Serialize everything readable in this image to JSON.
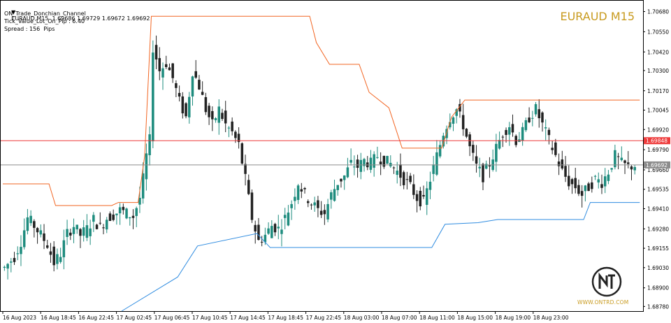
{
  "header": {
    "symbol_line": "EURAUD,M15  1.69686 1.69729 1.69672 1.69692",
    "indicator_name": "ON_Trade_Donchian_Channel",
    "tick_value": "Tick_Value_Lot_On_Pip : 6.40",
    "spread": "Spread : 156  Pips"
  },
  "chart_title": "EURAUD M15",
  "logo": {
    "text": "WWW.ONTRD.COM",
    "icon": "ontrd-logo-icon"
  },
  "colors": {
    "upper_band": "#f26522",
    "lower_band": "#2f8ce0",
    "hline_red": "#ee3b3b",
    "hline_gray": "#8c8c8c",
    "candle": "#1e8c7e",
    "candle_dark": "#222222",
    "title": "#c89a1e"
  },
  "price_axis": {
    "ticks": [
      "1.70680",
      "1.70550",
      "1.70420",
      "1.70300",
      "1.70170",
      "1.70045",
      "1.69920",
      "1.69790",
      "1.69660",
      "1.69535",
      "1.69410",
      "1.69280",
      "1.69155",
      "1.69030",
      "1.68900",
      "1.68780"
    ],
    "labels": [
      {
        "value": "1.69848",
        "color": "#ee3b3b"
      },
      {
        "value": "1.69692",
        "color": "#8c8c8c"
      }
    ]
  },
  "time_axis": [
    "16 Aug 2023",
    "16 Aug 18:45",
    "16 Aug 22:45",
    "17 Aug 02:45",
    "17 Aug 06:45",
    "17 Aug 10:45",
    "17 Aug 14:45",
    "17 Aug 18:45",
    "17 Aug 22:45",
    "18 Aug 03:00",
    "18 Aug 07:00",
    "18 Aug 11:00",
    "18 Aug 15:00",
    "18 Aug 19:00",
    "18 Aug 23:00"
  ],
  "chart_data": {
    "type": "line",
    "title": "EURAUD M15",
    "ylim": [
      1.6875,
      1.7075
    ],
    "hlines": [
      1.69848,
      1.69692
    ],
    "series": [
      {
        "name": "",
        "values": []
      }
    ],
    "close_path": [
      [
        0,
        1.6903
      ],
      [
        3,
        1.691
      ],
      [
        5,
        1.692
      ],
      [
        7,
        1.6935
      ],
      [
        9,
        1.693
      ],
      [
        11,
        1.6924
      ],
      [
        13,
        1.6918
      ],
      [
        15,
        1.6906
      ],
      [
        17,
        1.6912
      ],
      [
        19,
        1.6925
      ],
      [
        21,
        1.693
      ],
      [
        23,
        1.6924
      ],
      [
        25,
        1.6928
      ],
      [
        27,
        1.6934
      ],
      [
        29,
        1.6929
      ],
      [
        31,
        1.6935
      ],
      [
        33,
        1.6937
      ],
      [
        35,
        1.694
      ],
      [
        37,
        1.6938
      ],
      [
        39,
        1.6936
      ],
      [
        41,
        1.6948
      ],
      [
        42,
        1.696
      ],
      [
        43,
        1.6975
      ],
      [
        44,
        1.6985
      ],
      [
        45,
        1.7045
      ],
      [
        46,
        1.7038
      ],
      [
        47,
        1.703
      ],
      [
        49,
        1.7035
      ],
      [
        51,
        1.7025
      ],
      [
        53,
        1.701
      ],
      [
        55,
        1.7
      ],
      [
        57,
        1.703
      ],
      [
        59,
        1.702
      ],
      [
        61,
        1.7005
      ],
      [
        63,
        1.6995
      ],
      [
        65,
        1.7005
      ],
      [
        67,
        1.6995
      ],
      [
        69,
        1.699
      ],
      [
        71,
        1.6982
      ],
      [
        73,
        1.696
      ],
      [
        75,
        1.6935
      ],
      [
        77,
        1.692
      ],
      [
        79,
        1.6924
      ],
      [
        81,
        1.693
      ],
      [
        83,
        1.6928
      ],
      [
        85,
        1.6935
      ],
      [
        87,
        1.6945
      ],
      [
        89,
        1.6958
      ],
      [
        91,
        1.695
      ],
      [
        93,
        1.6945
      ],
      [
        95,
        1.694
      ],
      [
        97,
        1.6938
      ],
      [
        99,
        1.695
      ],
      [
        101,
        1.6958
      ],
      [
        103,
        1.6962
      ],
      [
        105,
        1.697
      ],
      [
        107,
        1.6968
      ],
      [
        109,
        1.6972
      ],
      [
        111,
        1.697
      ],
      [
        113,
        1.6975
      ],
      [
        115,
        1.6972
      ],
      [
        117,
        1.697
      ],
      [
        119,
        1.6965
      ],
      [
        121,
        1.696
      ],
      [
        123,
        1.6955
      ],
      [
        125,
        1.6948
      ],
      [
        127,
        1.6945
      ],
      [
        129,
        1.696
      ],
      [
        131,
        1.6975
      ],
      [
        133,
        1.699
      ],
      [
        135,
        1.7
      ],
      [
        137,
        1.7005
      ],
      [
        139,
        1.6995
      ],
      [
        141,
        1.698
      ],
      [
        143,
        1.6968
      ],
      [
        145,
        1.6962
      ],
      [
        147,
        1.697
      ],
      [
        149,
        1.698
      ],
      [
        151,
        1.699
      ],
      [
        153,
        1.6995
      ],
      [
        155,
        1.6985
      ],
      [
        157,
        1.699
      ],
      [
        159,
        1.7
      ],
      [
        161,
        1.7005
      ],
      [
        163,
        1.6995
      ],
      [
        165,
        1.6985
      ],
      [
        167,
        1.6975
      ],
      [
        169,
        1.6965
      ],
      [
        171,
        1.6958
      ],
      [
        173,
        1.6955
      ],
      [
        175,
        1.695
      ],
      [
        177,
        1.6955
      ],
      [
        179,
        1.696
      ],
      [
        181,
        1.6958
      ],
      [
        183,
        1.6965
      ],
      [
        185,
        1.6975
      ],
      [
        187,
        1.697
      ],
      [
        189,
        1.6968
      ],
      [
        191,
        1.6969
      ]
    ],
    "upper_band": [
      [
        0,
        1.6957
      ],
      [
        14,
        1.6957
      ],
      [
        16,
        1.6943
      ],
      [
        33,
        1.6943
      ],
      [
        35,
        1.6945
      ],
      [
        41,
        1.6945
      ],
      [
        43,
        1.6975
      ],
      [
        45,
        1.7065
      ],
      [
        54,
        1.7065
      ],
      [
        93,
        1.7065
      ],
      [
        95,
        1.7048
      ],
      [
        99,
        1.7034
      ],
      [
        108,
        1.7034
      ],
      [
        111,
        1.7016
      ],
      [
        117,
        1.7006
      ],
      [
        121,
        1.698
      ],
      [
        133,
        1.698
      ],
      [
        136,
        1.7
      ],
      [
        140,
        1.7011
      ],
      [
        162,
        1.7011
      ],
      [
        193,
        1.7011
      ]
    ],
    "lower_band": [
      [
        36,
        1.6875
      ],
      [
        53,
        1.6897
      ],
      [
        59,
        1.6917
      ],
      [
        77,
        1.6925
      ],
      [
        81,
        1.6916
      ],
      [
        130,
        1.6916
      ],
      [
        134,
        1.6931
      ],
      [
        144,
        1.6932
      ],
      [
        150,
        1.6934
      ],
      [
        176,
        1.6934
      ],
      [
        178,
        1.6945
      ],
      [
        193,
        1.6945
      ]
    ]
  }
}
